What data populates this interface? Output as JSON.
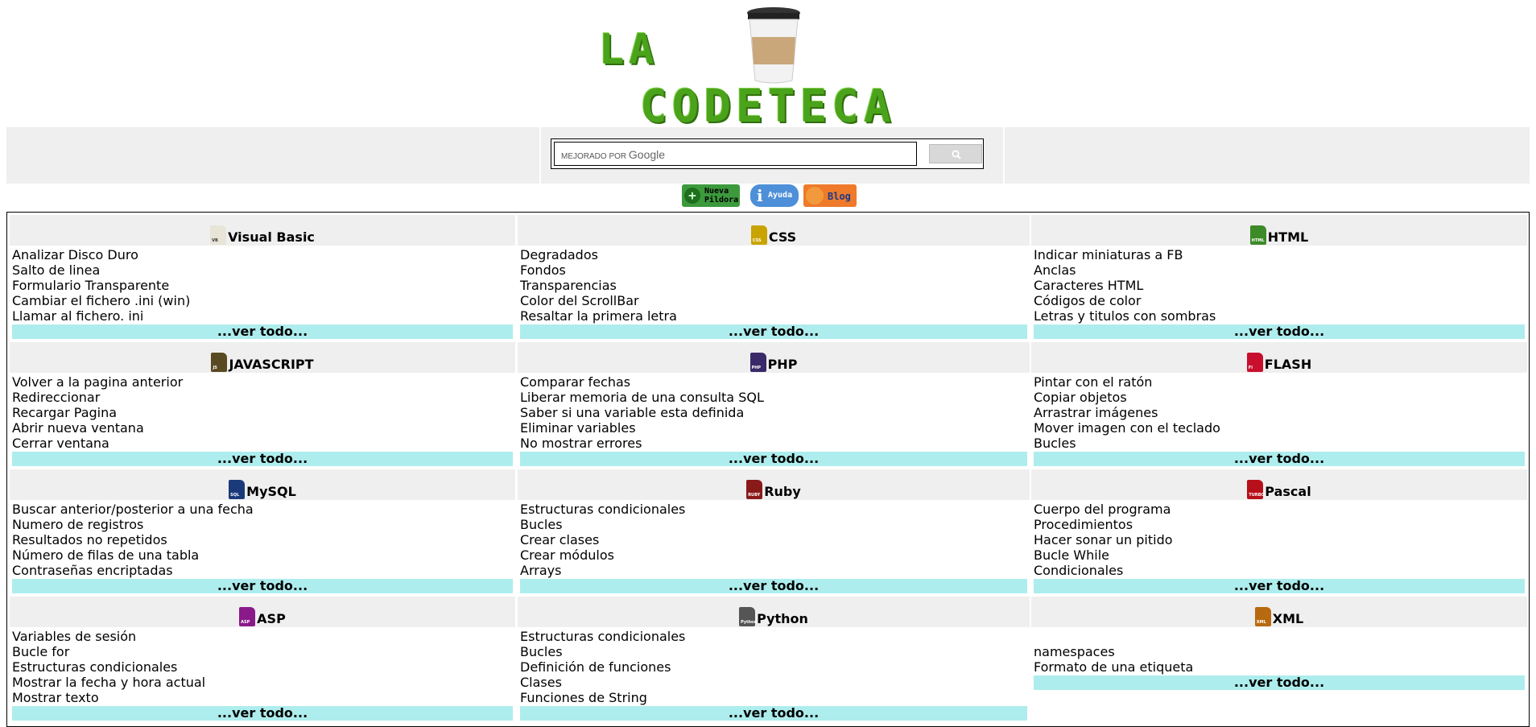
{
  "logo": {
    "line1": "LA",
    "line2": "CODETECA"
  },
  "search": {
    "branding": "MEJORADO POR",
    "brand": "Google"
  },
  "badges": {
    "new_label": "Nueva Pildora",
    "help_label": "Ayuda",
    "blog_label": "Blog"
  },
  "more_label": "...ver todo...",
  "categories": [
    {
      "name": "Visual Basic",
      "icon": "vb-file-icon",
      "icon_text": "VB",
      "color": "#e8e4d8",
      "items": [
        "Analizar Disco Duro",
        "Salto de linea",
        "Formulario Transparente",
        "Cambiar el fichero .ini (win)",
        "Llamar al fichero. ini"
      ]
    },
    {
      "name": "CSS",
      "icon": "css-file-icon",
      "icon_text": "CSS",
      "color": "#c9a400",
      "items": [
        "Degradados",
        "Fondos",
        "Transparencias",
        "Color del ScrollBar",
        "Resaltar la primera letra"
      ]
    },
    {
      "name": "HTML",
      "icon": "html-file-icon",
      "icon_text": "HTML",
      "color": "#3d8a28",
      "items": [
        "Indicar miniaturas a FB",
        "Anclas",
        "Caracteres HTML",
        "Códigos de color",
        "Letras y titulos con sombras"
      ]
    },
    {
      "name": "JAVASCRIPT",
      "icon": "javascript-file-icon",
      "icon_text": "JS",
      "color": "#5a4a22",
      "items": [
        "Volver a la pagina anterior",
        "Redireccionar",
        "Recargar Pagina",
        "Abrir nueva ventana",
        "Cerrar ventana"
      ]
    },
    {
      "name": "PHP",
      "icon": "php-file-icon",
      "icon_text": "PHP",
      "color": "#3a2a6a",
      "items": [
        "Comparar fechas",
        "Liberar memoria de una consulta SQL",
        "Saber si una variable esta definida",
        "Eliminar variables",
        "No mostrar errores"
      ]
    },
    {
      "name": "FLASH",
      "icon": "flash-file-icon",
      "icon_text": "Fl",
      "color": "#c8102e",
      "items": [
        "Pintar con el ratón",
        "Copiar objetos",
        "Arrastrar imágenes",
        "Mover imagen con el teclado",
        "Bucles"
      ]
    },
    {
      "name": "MySQL",
      "icon": "mysql-file-icon",
      "icon_text": "SQL",
      "color": "#1a3a7a",
      "items": [
        "Buscar anterior/posterior a una fecha",
        "Numero de registros",
        "Resultados no repetidos",
        "Número de filas de una tabla",
        "Contraseñas encriptadas"
      ]
    },
    {
      "name": "Ruby",
      "icon": "ruby-file-icon",
      "icon_text": "RUBY",
      "color": "#8a1a1a",
      "items": [
        "Estructuras condicionales",
        "Bucles",
        "Crear clases",
        "Crear módulos",
        "Arrays"
      ]
    },
    {
      "name": "Pascal",
      "icon": "pascal-turbo-icon",
      "icon_text": "TURBO",
      "color": "#b8101a",
      "items": [
        "Cuerpo del programa",
        "Procedimientos",
        "Hacer sonar un pitido",
        "Bucle While",
        "Condicionales"
      ]
    },
    {
      "name": "ASP",
      "icon": "asp-file-icon",
      "icon_text": "ASP",
      "color": "#8a1a8a",
      "items": [
        "Variables de sesión",
        "Bucle for",
        "Estructuras condicionales",
        "Mostrar la fecha y hora actual",
        "Mostrar texto"
      ]
    },
    {
      "name": "Python",
      "icon": "python-file-icon",
      "icon_text": "Python",
      "color": "#555555",
      "items": [
        "Estructuras condicionales",
        "Bucles",
        "Definición de funciones",
        "Clases",
        "Funciones de String"
      ]
    },
    {
      "name": "XML",
      "icon": "xml-file-icon",
      "icon_text": "XML",
      "color": "#b86a10",
      "items": [
        "",
        "namespaces",
        "Formato de una etiqueta"
      ]
    }
  ]
}
